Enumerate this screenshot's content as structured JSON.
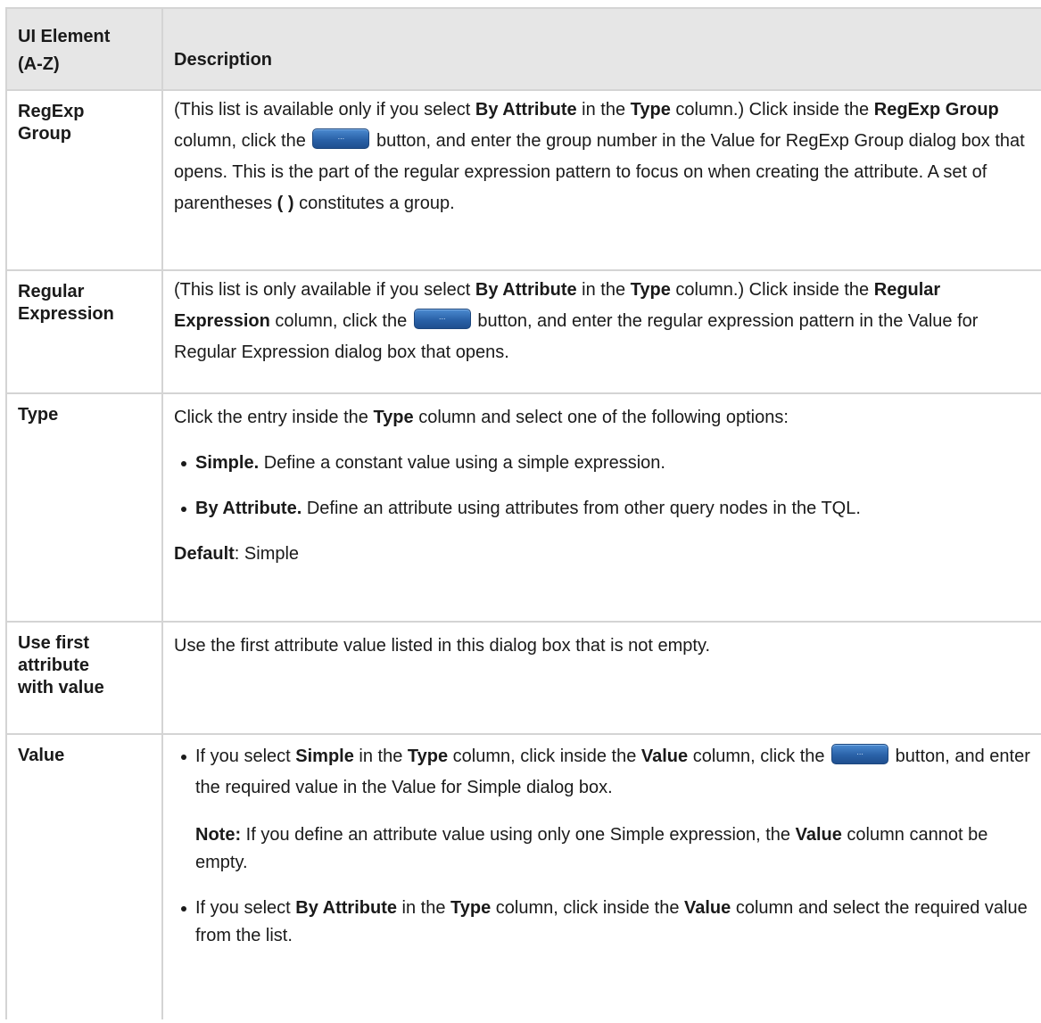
{
  "header": {
    "col1_line1": "UI Element",
    "col1_line2": "(A-Z)",
    "col2": "Description"
  },
  "regexp_group": {
    "name_line1": "RegExp",
    "name_line2": "Group",
    "t1": "(This list is available only if you select ",
    "b1": "By Attribute",
    "t2": " in the ",
    "b2": "Type",
    "t3": " column.) Click inside the ",
    "b3": "RegExp Group",
    "t4": " column, click the ",
    "t5": " button, and enter the group number in the Value for RegExp Group dialog box that opens. This is the part of the regular expression pattern to focus on when creating the attribute. A set of parentheses ",
    "b4": "( )",
    "t6": " constitutes a group."
  },
  "regular_expression": {
    "name_line1": "Regular",
    "name_line2": "Expression",
    "t1": "(This list is only available if you select ",
    "b1": "By Attribute",
    "t2": " in the ",
    "b2": "Type",
    "t3": " column.) Click inside the ",
    "b3": "Regular Expression",
    "t4": " column, click the ",
    "t5": " button, and enter the regular expression pattern in the Value for Regular Expression dialog box that opens."
  },
  "type_row": {
    "name": "Type",
    "intro_t1": "Click the entry inside the ",
    "intro_b1": "Type",
    "intro_t2": " column and select one of the following options:",
    "opt1_b": "Simple.",
    "opt1_t": " Define a constant value using a simple expression.",
    "opt2_b": "By Attribute.",
    "opt2_t": " Define an attribute using attributes from other query nodes in the TQL.",
    "default_b": "Default",
    "default_t": ": Simple"
  },
  "use_first": {
    "name_line1": "Use first",
    "name_line2": "attribute",
    "name_line3": "with value",
    "text": "Use the first attribute value listed in this dialog box that is not empty."
  },
  "value_row": {
    "name": "Value",
    "b1_t1": "If you select ",
    "b1_b1": "Simple",
    "b1_t2": " in the ",
    "b1_b2": "Type",
    "b1_t3": " column, click inside the ",
    "b1_b3": "Value",
    "b1_t4": " column, click the ",
    "b1_t5": " button, and enter the required value in the Value for Simple dialog box.",
    "note_b": "Note:",
    "note_t1": " If you define an attribute value using only one Simple expression, the ",
    "note_b2": "Value",
    "note_t2": " column cannot be empty.",
    "b2_t1": "If you select ",
    "b2_b1": "By Attribute",
    "b2_t2": " in the ",
    "b2_b2": "Type",
    "b2_t3": " column, click inside the ",
    "b2_b3": "Value",
    "b2_t4": " column and select the required value from the list."
  },
  "icons": {
    "button": "ellipsis-button-icon"
  }
}
